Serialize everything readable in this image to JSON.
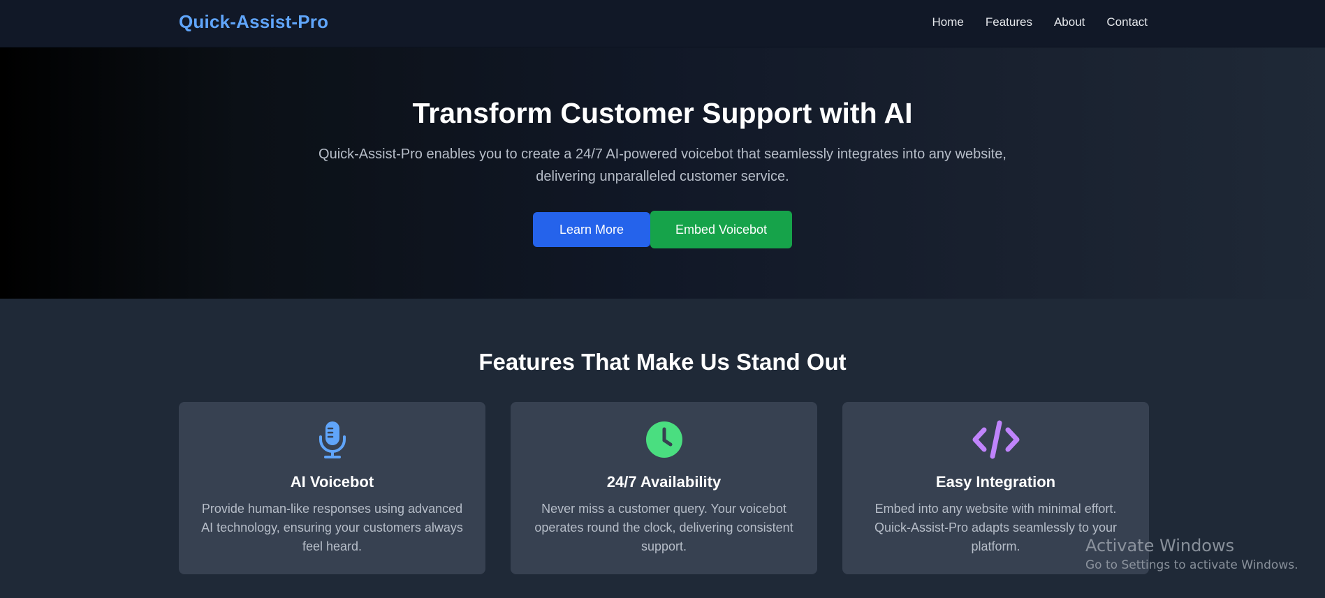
{
  "nav": {
    "brand": "Quick-Assist-Pro",
    "links": [
      "Home",
      "Features",
      "About",
      "Contact"
    ]
  },
  "hero": {
    "title": "Transform Customer Support with AI",
    "subtitle": "Quick-Assist-Pro enables you to create a 24/7 AI-powered voicebot that seamlessly integrates into any website, delivering unparalleled customer service.",
    "primary_button": "Learn More",
    "secondary_button": "Embed Voicebot"
  },
  "features": {
    "title": "Features That Make Us Stand Out",
    "cards": [
      {
        "icon": "microphone-icon",
        "icon_color": "#60a5fa",
        "title": "AI Voicebot",
        "text": "Provide human-like responses using advanced AI technology, ensuring your customers always feel heard."
      },
      {
        "icon": "clock-icon",
        "icon_color": "#4ade80",
        "title": "24/7 Availability",
        "text": "Never miss a customer query. Your voicebot operates round the clock, delivering consistent support."
      },
      {
        "icon": "code-icon",
        "icon_color": "#c084fc",
        "title": "Easy Integration",
        "text": "Embed into any website with minimal effort. Quick-Assist-Pro adapts seamlessly to your platform."
      }
    ]
  },
  "watermark": {
    "title": "Activate Windows",
    "subtitle": "Go to Settings to activate Windows."
  },
  "colors": {
    "brand": "#60a5fa",
    "primary_button": "#2563eb",
    "success_button": "#16a34a",
    "card_bg": "#374151",
    "page_bg": "#1f2937",
    "nav_bg": "#111827"
  }
}
